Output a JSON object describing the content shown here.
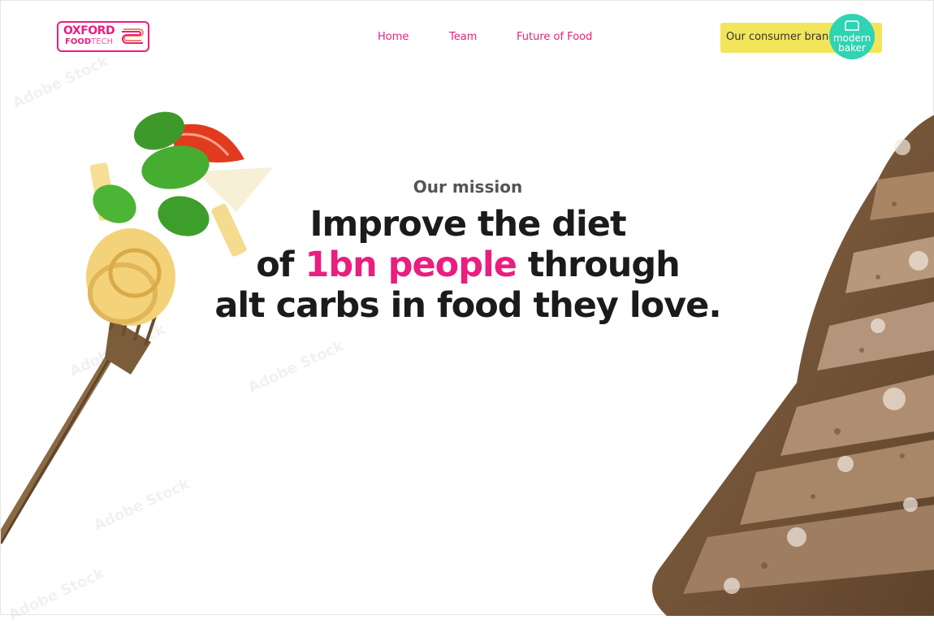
{
  "logo": {
    "line1": "OXFORD",
    "line2_bold": "FOOD",
    "line2_light": "TECH",
    "color": "#e91e7f"
  },
  "nav": {
    "items": [
      {
        "label": "Home"
      },
      {
        "label": "Team"
      },
      {
        "label": "Future of Food"
      }
    ]
  },
  "consumer_brand": {
    "label": "Our consumer brand",
    "badge_line1": "modern",
    "badge_line2": "baker",
    "pill_color": "#f2e55a",
    "badge_color": "#2fd4b2"
  },
  "hero": {
    "eyebrow": "Our mission",
    "line1": "Improve the diet",
    "line2_pre": "of ",
    "line2_highlight": "1bn people",
    "line2_post": " through",
    "line3": "alt carbs in food they love.",
    "highlight_color": "#e91e7f"
  },
  "images": {
    "left": "fork-with-pasta",
    "right": "sliced-bread"
  },
  "watermark": "Adobe Stock"
}
